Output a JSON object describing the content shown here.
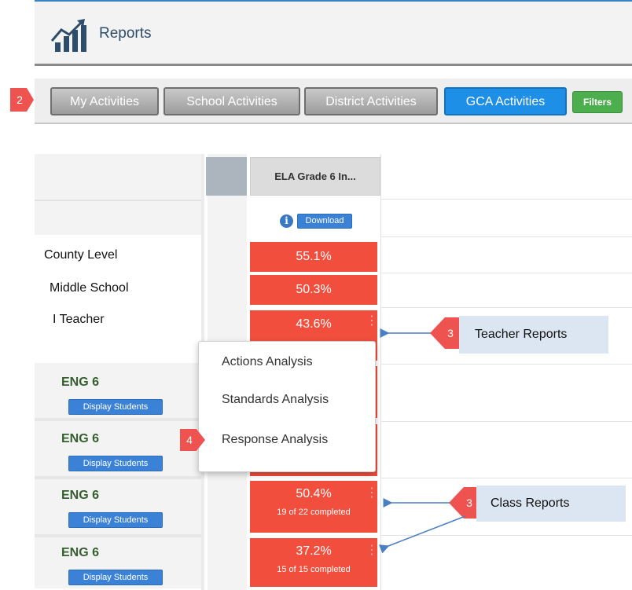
{
  "header": {
    "title": "Reports",
    "icon": "chart-growth-icon"
  },
  "tabs": [
    {
      "label": "My Activities",
      "style": "gray"
    },
    {
      "label": "School Activities",
      "style": "gray"
    },
    {
      "label": "District Activities",
      "style": "gray"
    },
    {
      "label": "GCA Activities",
      "style": "blue"
    },
    {
      "label": "Filters",
      "style": "green"
    }
  ],
  "markers": {
    "tabs": "2",
    "teacher": "3",
    "menu": "4",
    "class": "3"
  },
  "table": {
    "column_header": "ELA Grade 6 In...",
    "download_label": "Download",
    "rows": [
      {
        "label": "County Level",
        "pct": "55.1%"
      },
      {
        "label": "Middle School",
        "pct": "50.3%"
      },
      {
        "label": "I Teacher",
        "pct": "43.6%"
      }
    ],
    "classes": [
      {
        "name": "ENG 6",
        "button": "Display Students",
        "pct": "",
        "sub": ""
      },
      {
        "name": "ENG 6",
        "button": "Display Students",
        "pct": "",
        "sub": ""
      },
      {
        "name": "ENG 6",
        "button": "Display Students",
        "pct": "50.4%",
        "sub": "19 of 22 completed"
      },
      {
        "name": "ENG 6",
        "button": "Display Students",
        "pct": "37.2%",
        "sub": "15 of 15 completed"
      }
    ]
  },
  "menu": {
    "items": [
      "Actions Analysis",
      "Standards Analysis",
      "Response Analysis"
    ]
  },
  "callouts": {
    "teacher": "Teacher Reports",
    "class": "Class Reports"
  },
  "colors": {
    "accent_blue": "#1e8fe6",
    "red_cell": "#f14e3d",
    "marker": "#ef5350",
    "callout_bg": "#dce6f2"
  }
}
